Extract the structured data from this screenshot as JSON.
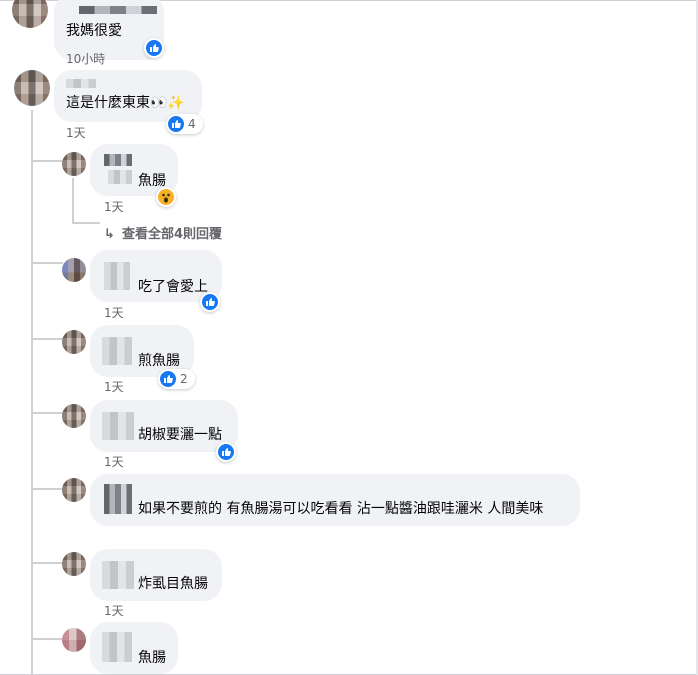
{
  "comments": [
    {
      "text": "我媽很愛",
      "time": "10小時"
    },
    {
      "text": "這是什麼東東👀✨",
      "time": "1天",
      "reactions": "4"
    }
  ],
  "replies": [
    {
      "text": "魚腸",
      "time": "1天",
      "reaction_icon": "wow-icon"
    },
    {
      "text": "吃了會愛上",
      "time": "1天",
      "reaction_icon": "like-icon"
    },
    {
      "text": "煎魚腸",
      "time": "1天",
      "reactions": "2"
    },
    {
      "text": "胡椒要灑一點",
      "time": "1天",
      "reaction_icon": "like-icon"
    },
    {
      "text": "如果不要煎的 有魚腸湯可以吃看看 沾一點醬油跟哇灑米 人間美味",
      "time": ""
    },
    {
      "text": "炸虱目魚腸",
      "time": "1天"
    },
    {
      "text": "魚腸",
      "time": ""
    }
  ],
  "view_replies": "查看全部4則回覆",
  "colors": {
    "like_blue": "#1877f2",
    "bubble": "#f0f2f5",
    "meta": "#65676b",
    "wow": "#f7b125"
  }
}
